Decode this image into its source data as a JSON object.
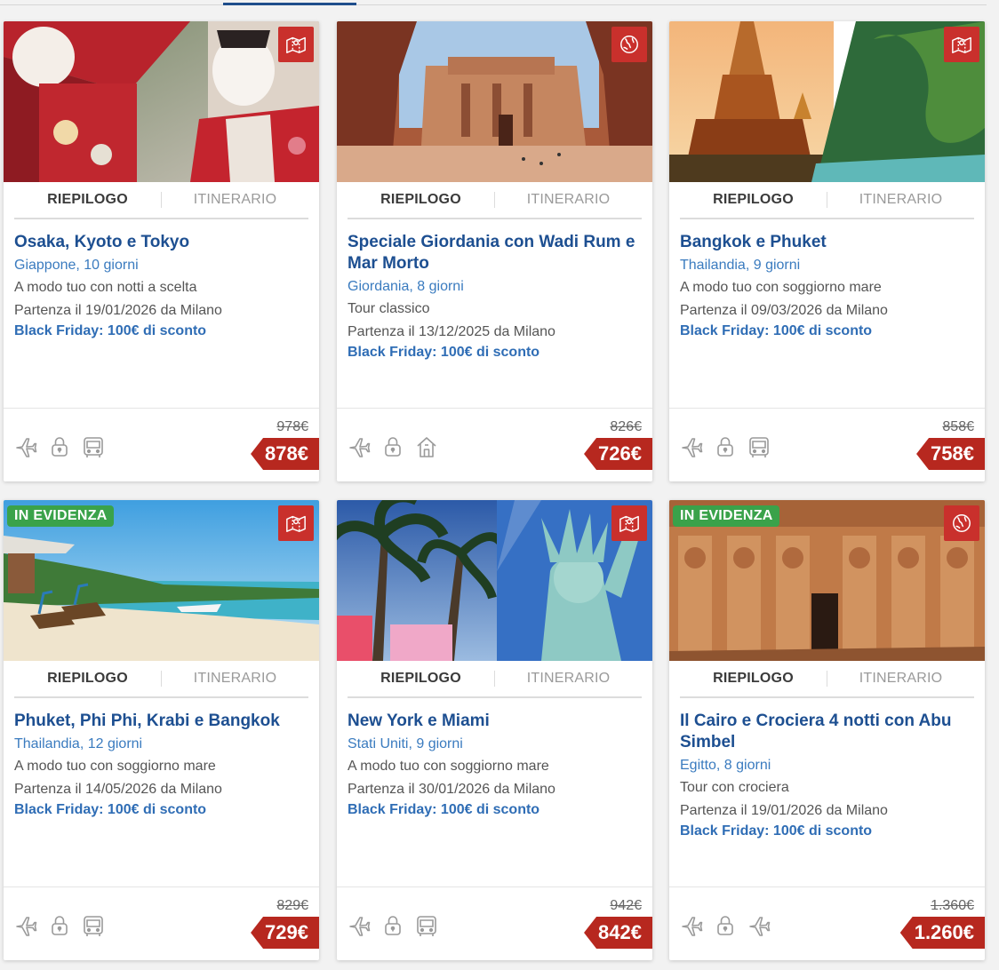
{
  "tabs_label": {
    "summary": "RIEPILOGO",
    "itinerary": "ITINERARIO"
  },
  "colors": {
    "primary": "#1d4f91",
    "link": "#3a7bbf",
    "price": "#b7281f",
    "badge": "#c9302c",
    "evidence": "#3aa24a"
  },
  "cards": [
    {
      "title": "Osaka, Kyoto e Tokyo",
      "destination": "Giappone, 10 giorni",
      "mode": "A modo tuo con notti a scelta",
      "departure": "Partenza il 19/01/2026 da Milano",
      "promo": "Black Friday: 100€ di sconto",
      "old_price": "978€",
      "price": "878€",
      "badge": "",
      "type_icon": "map-route-icon",
      "features": [
        "plane-icon",
        "lock-icon",
        "bus-icon"
      ]
    },
    {
      "title": "Speciale Giordania con Wadi Rum e Mar Morto",
      "destination": "Giordania, 8 giorni",
      "mode": "Tour classico",
      "departure": "Partenza il 13/12/2025 da Milano",
      "promo": "Black Friday: 100€ di sconto",
      "old_price": "826€",
      "price": "726€",
      "badge": "",
      "type_icon": "globe-icon",
      "features": [
        "plane-icon",
        "lock-icon",
        "hotel-icon"
      ]
    },
    {
      "title": "Bangkok e Phuket",
      "destination": "Thailandia, 9 giorni",
      "mode": "A modo tuo con soggiorno mare",
      "departure": "Partenza il 09/03/2026 da Milano",
      "promo": "Black Friday: 100€ di sconto",
      "old_price": "858€",
      "price": "758€",
      "badge": "",
      "type_icon": "map-route-icon",
      "features": [
        "plane-icon",
        "lock-icon",
        "bus-icon"
      ]
    },
    {
      "title": "Phuket, Phi Phi, Krabi e Bangkok",
      "destination": "Thailandia, 12 giorni",
      "mode": "A modo tuo con soggiorno mare",
      "departure": "Partenza il 14/05/2026 da Milano",
      "promo": "Black Friday: 100€ di sconto",
      "old_price": "829€",
      "price": "729€",
      "badge": "IN EVIDENZA",
      "type_icon": "map-route-icon",
      "features": [
        "plane-icon",
        "lock-icon",
        "bus-icon"
      ]
    },
    {
      "title": "New York e Miami",
      "destination": "Stati Uniti, 9 giorni",
      "mode": "A modo tuo con soggiorno mare",
      "departure": "Partenza il 30/01/2026 da Milano",
      "promo": "Black Friday: 100€ di sconto",
      "old_price": "942€",
      "price": "842€",
      "badge": "",
      "type_icon": "map-route-icon",
      "features": [
        "plane-icon",
        "lock-icon",
        "bus-icon"
      ]
    },
    {
      "title": "Il Cairo e Crociera 4 notti con Abu Simbel",
      "destination": "Egitto, 8 giorni",
      "mode": "Tour con crociera",
      "departure": "Partenza il 19/01/2026 da Milano",
      "promo": "Black Friday: 100€ di sconto",
      "old_price": "1.360€",
      "price": "1.260€",
      "badge": "IN EVIDENZA",
      "type_icon": "globe-icon",
      "features": [
        "plane-icon",
        "lock-icon",
        "plane-icon"
      ]
    }
  ]
}
